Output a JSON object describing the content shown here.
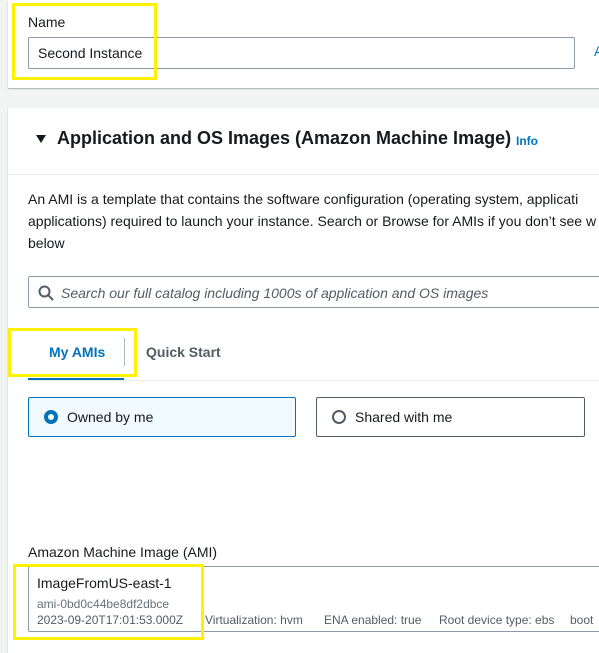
{
  "name_section": {
    "label": "Name",
    "value": "Second Instance",
    "side_link": "A"
  },
  "ami_section": {
    "title": "Application and OS Images (Amazon Machine Image)",
    "info": "Info",
    "description_lines": [
      "An AMI is a template that contains the software configuration (operating system, applicati",
      "applications) required to launch your instance. Search or Browse for AMIs if you don’t see w",
      "below"
    ],
    "search": {
      "placeholder": "Search our full catalog including 1000s of application and OS images"
    },
    "tabs": [
      {
        "label": "My AMIs",
        "active": true
      },
      {
        "label": "Quick Start",
        "active": false
      }
    ],
    "ownership_options": [
      {
        "label": "Owned by me",
        "selected": true
      },
      {
        "label": "Shared with me",
        "selected": false
      }
    ],
    "ami_field": {
      "label": "Amazon Machine Image (AMI)",
      "name": "ImageFromUS-east-1",
      "id": "ami-0bd0c44be8df2dbce",
      "created": "2023-09-20T17:01:53.000Z",
      "virtualization": "Virtualization: hvm",
      "ena": "ENA enabled: true",
      "root_device": "Root device type: ebs",
      "boot": "boot"
    }
  },
  "colors": {
    "accent": "#0073bb",
    "highlight": "#fff200"
  }
}
